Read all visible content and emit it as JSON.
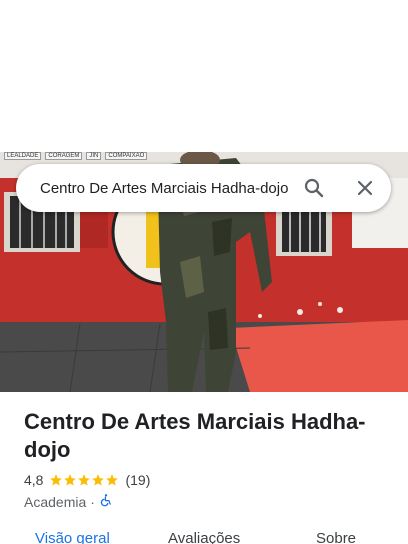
{
  "search": {
    "query": "Centro De Artes Marciais Hadha-dojo",
    "search_icon": "search-icon",
    "close_icon": "close-icon"
  },
  "hero_photo": {
    "wall_signs": [
      "LEALDADE",
      "CORAGEM",
      "JIN",
      "COMPAIXÃO"
    ]
  },
  "place": {
    "name": "Centro De Artes Marciais Hadha-dojo",
    "rating": "4,8",
    "rating_value": 4.8,
    "review_count": "(19)",
    "category": "Academia",
    "separator": "·",
    "accessibility_icon": "wheelchair-icon"
  },
  "tabs": [
    {
      "label": "Visão geral",
      "active": true
    },
    {
      "label": "Avaliações",
      "active": false
    },
    {
      "label": "Sobre",
      "active": false
    }
  ],
  "colors": {
    "accent": "#1a73e8",
    "star": "#fbbc04",
    "wall_red": "#c4302b",
    "mat_red": "#e8574a"
  }
}
